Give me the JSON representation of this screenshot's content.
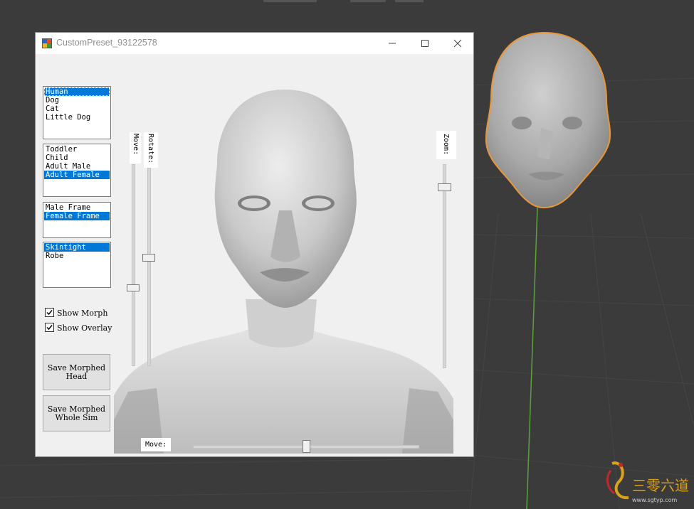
{
  "window": {
    "title": "CustomPreset_93122578",
    "controls": {
      "minimize": "minimize",
      "maximize": "maximize",
      "close": "close"
    }
  },
  "species_list": {
    "items": [
      "Human",
      "Dog",
      "Cat",
      "Little Dog"
    ],
    "selected": "Human"
  },
  "age_list": {
    "items": [
      "Toddler",
      "Child",
      "Adult Male",
      "Adult Female"
    ],
    "selected": "Adult Female"
  },
  "frame_list": {
    "items": [
      "Male Frame",
      "Female Frame"
    ],
    "selected": "Female Frame"
  },
  "outfit_list": {
    "items": [
      "Skintight",
      "Robe"
    ],
    "selected": "Skintight"
  },
  "options": {
    "show_morph": {
      "label": "Show Morph",
      "checked": true
    },
    "show_overlay": {
      "label": "Show Overlay",
      "checked": true
    }
  },
  "buttons": {
    "save_head": "Save Morphed\nHead",
    "save_sim": "Save Morphed\nWhole Sim"
  },
  "sliders": {
    "move_vertical": {
      "label": "Move:",
      "value": 0.64
    },
    "rotate": {
      "label": "Rotate:",
      "value": 0.5
    },
    "zoom": {
      "label": "Zoom:",
      "value": 0.1
    },
    "move_horizontal": {
      "label": "Move:",
      "value": 0.5
    }
  },
  "colors": {
    "selection": "#0078d7",
    "head_outline": "#e8963a",
    "viewport_bg": "#3b3b3b",
    "axis_line": "#5aa43a"
  },
  "watermark": {
    "text": "三零六道",
    "url": "www.sgtyp.com"
  }
}
